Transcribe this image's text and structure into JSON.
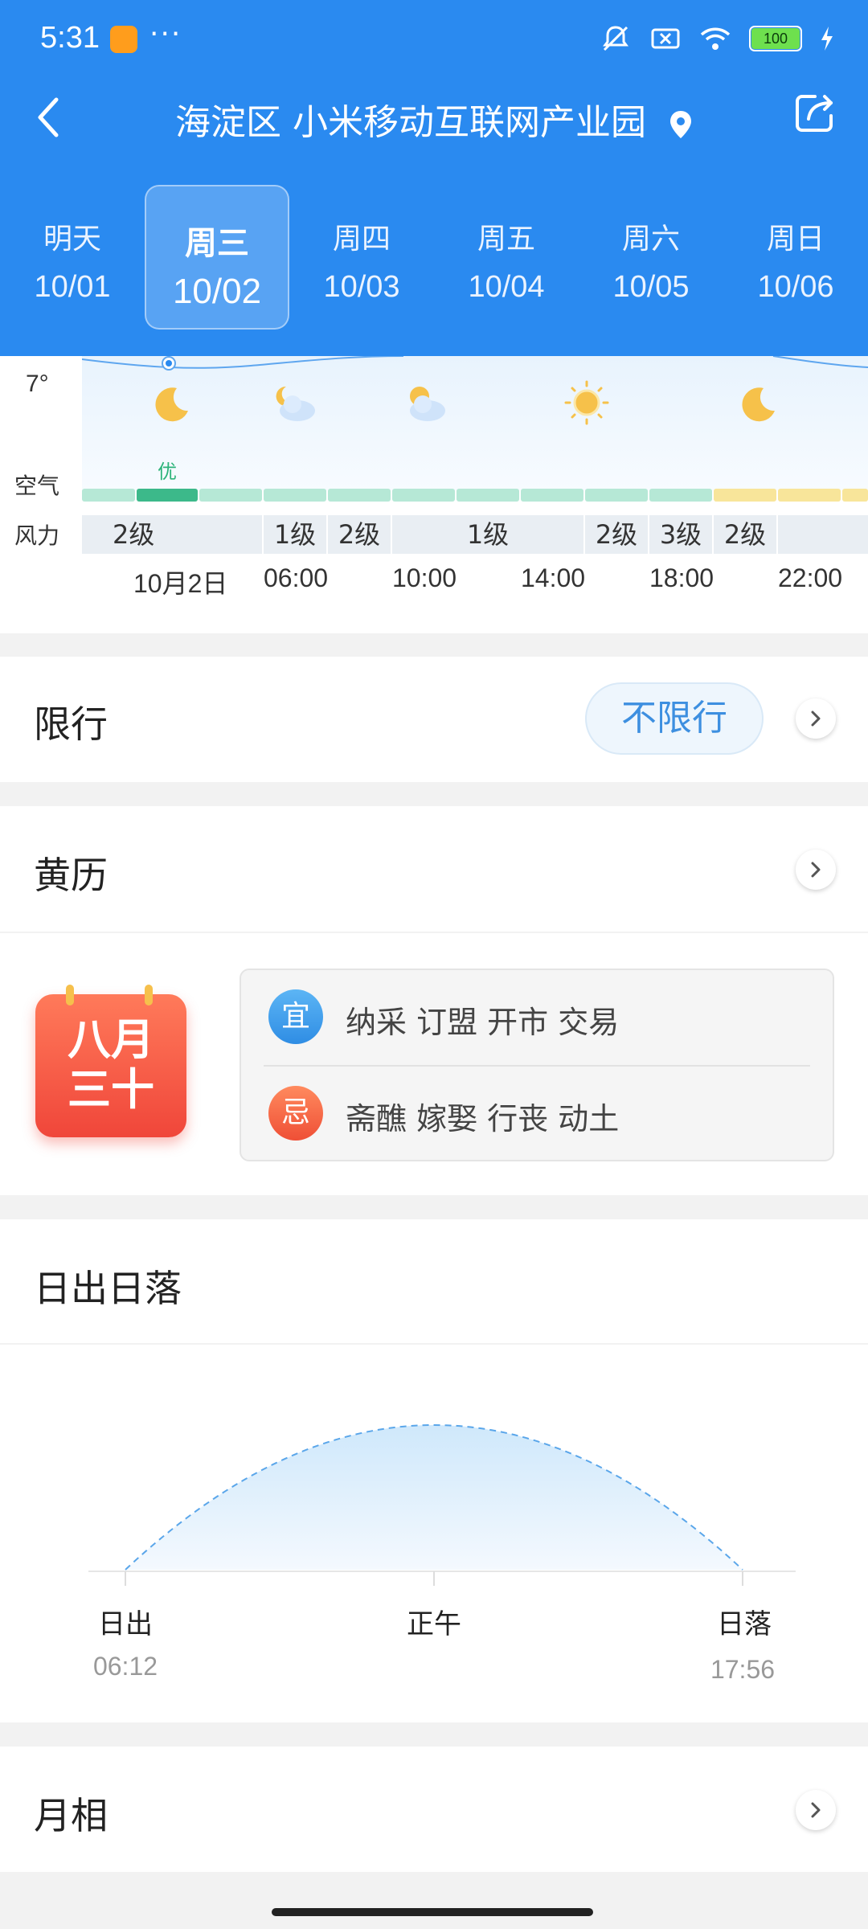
{
  "status_bar": {
    "time": "5:31",
    "more": "···",
    "battery": "100"
  },
  "header": {
    "title": "海淀区 小米移动互联网产业园"
  },
  "days": [
    {
      "week": "明天",
      "date": "10/01"
    },
    {
      "week": "周三",
      "date": "10/02"
    },
    {
      "week": "周四",
      "date": "10/03"
    },
    {
      "week": "周五",
      "date": "10/04"
    },
    {
      "week": "周六",
      "date": "10/05"
    },
    {
      "week": "周日",
      "date": "10/06"
    }
  ],
  "hourly": {
    "temp": "7°",
    "air_label": "空气",
    "air_quality_text": "优",
    "wind_label": "风力",
    "wind": [
      "2级",
      "1级",
      "2级",
      "1级",
      "2级",
      "3级",
      "2级"
    ],
    "hours": [
      "10月2日",
      "06:00",
      "10:00",
      "14:00",
      "18:00",
      "22:00"
    ],
    "icons": [
      "moon-icon",
      "partly-cloudy-night-icon",
      "partly-cloudy-day-icon",
      "sun-icon",
      "moon-icon"
    ]
  },
  "xianxing": {
    "title": "限行",
    "value": "不限行"
  },
  "huangli": {
    "title": "黄历",
    "lunar_line1": "八月",
    "lunar_line2": "三十",
    "yi_badge": "宜",
    "yi_text": "纳采  订盟  开市  交易",
    "ji_badge": "忌",
    "ji_text": "斋醮  嫁娶  行丧  动土"
  },
  "sun": {
    "title": "日出日落",
    "sunrise_label": "日出",
    "sunrise_time": "06:12",
    "noon_label": "正午",
    "sunset_label": "日落",
    "sunset_time": "17:56"
  },
  "moon": {
    "title": "月相"
  },
  "colors": {
    "header_blue": "#2a8af0",
    "air_good": "#b6e8d6",
    "air_good_dark": "#3cb98a",
    "air_moderate": "#f8e59a"
  }
}
